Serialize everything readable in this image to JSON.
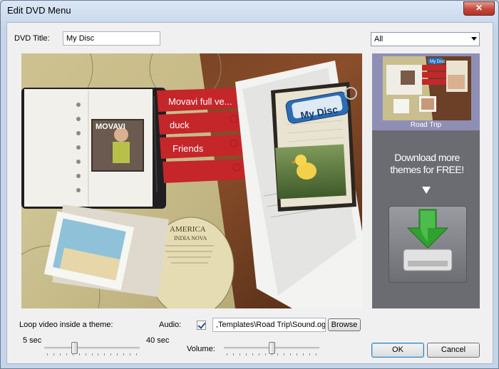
{
  "window": {
    "title": "Edit DVD Menu",
    "close_glyph": "✕"
  },
  "form": {
    "dvd_title_label": "DVD Title:",
    "dvd_title_value": "My Disc",
    "theme_filter": "All"
  },
  "preview": {
    "menu_items": [
      "Movavi full ve...",
      "duck",
      "Friends",
      ""
    ],
    "disc_tag": "My Disc",
    "logo_text": "MOVAVI",
    "map_text_1": "AMERICA",
    "map_text_2": "INDIA NOVA"
  },
  "themes": {
    "selected_name": "Road Trip",
    "thumb_tag": "My Disc",
    "download_text": "Download more themes for FREE!"
  },
  "loop": {
    "label": "Loop video inside a theme:",
    "min_label": "5 sec",
    "max_label": "40 sec",
    "value_fraction": 0.3
  },
  "audio": {
    "label": "Audio:",
    "enabled": true,
    "path": ",Templates\\Road Trip\\Sound.ogg",
    "browse_label": "Browse",
    "volume_label": "Volume:",
    "volume_fraction": 0.5
  },
  "buttons": {
    "ok": "OK",
    "cancel": "Cancel"
  },
  "colors": {
    "accent_red": "#c4262a",
    "download_green": "#2fa12f",
    "theme_bg": "#6b6c72"
  }
}
